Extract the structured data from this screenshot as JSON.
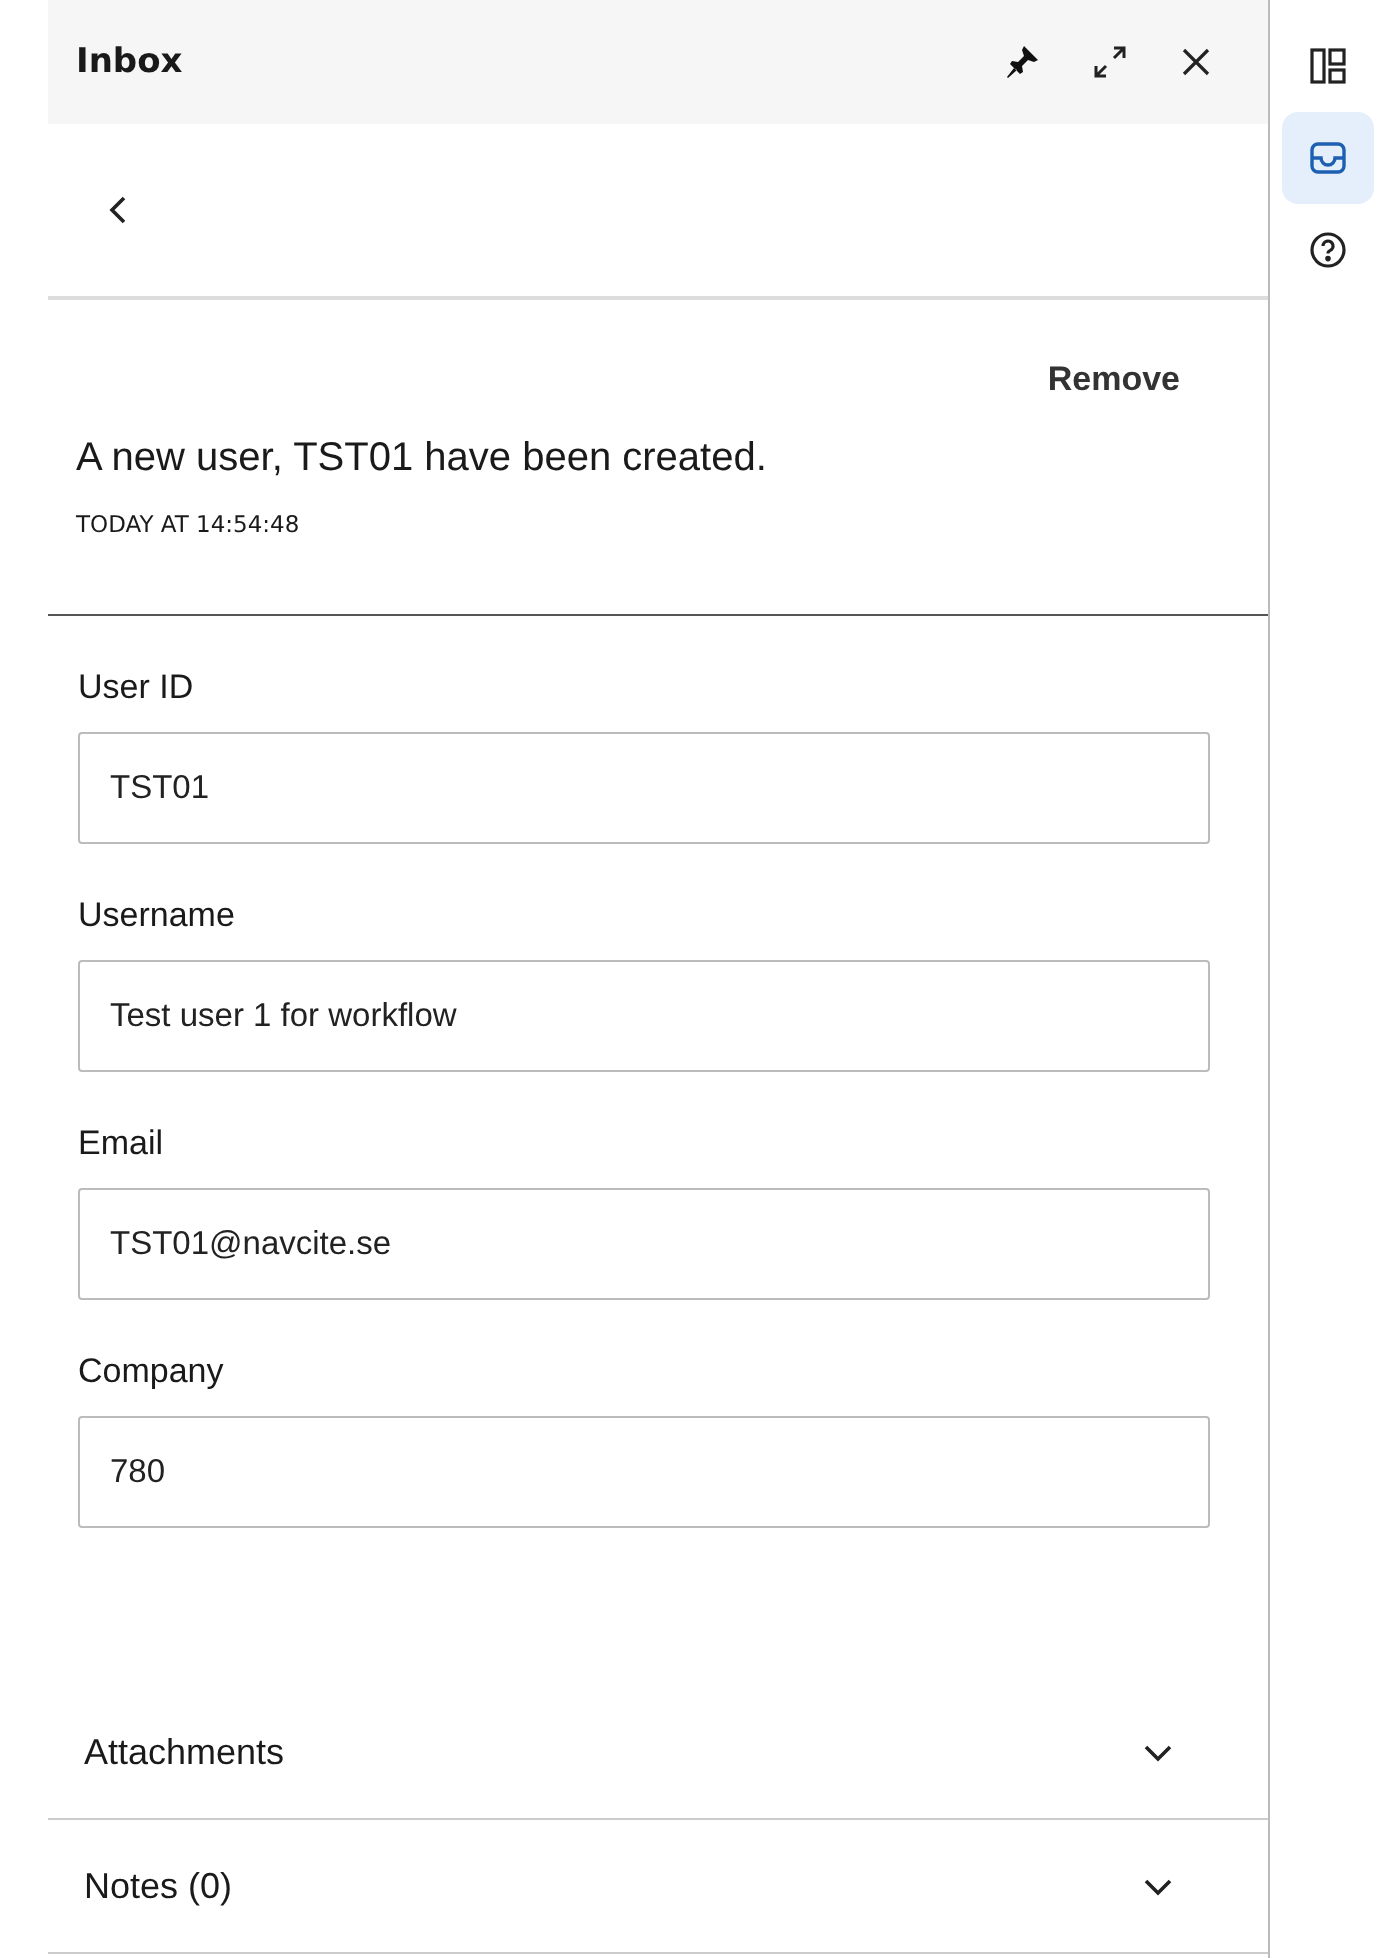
{
  "panel": {
    "title": "Inbox"
  },
  "rail": [
    {
      "kind": "layout",
      "selected": false
    },
    {
      "kind": "inbox",
      "selected": true
    },
    {
      "kind": "help",
      "selected": false
    }
  ],
  "message": {
    "action": "Remove",
    "text": "A new user, TST01 have been created.",
    "timestamp": "TODAY AT  14:54:48"
  },
  "fields": [
    {
      "label": "User ID",
      "value": "TST01"
    },
    {
      "label": "Username",
      "value": "Test user 1 for workflow"
    },
    {
      "label": "Email",
      "value": "TST01@navcite.se"
    },
    {
      "label": "Company",
      "value": "780"
    }
  ],
  "sections": [
    {
      "label": "Attachments",
      "expanded": false
    },
    {
      "label": "Notes (0)",
      "expanded": false
    }
  ]
}
